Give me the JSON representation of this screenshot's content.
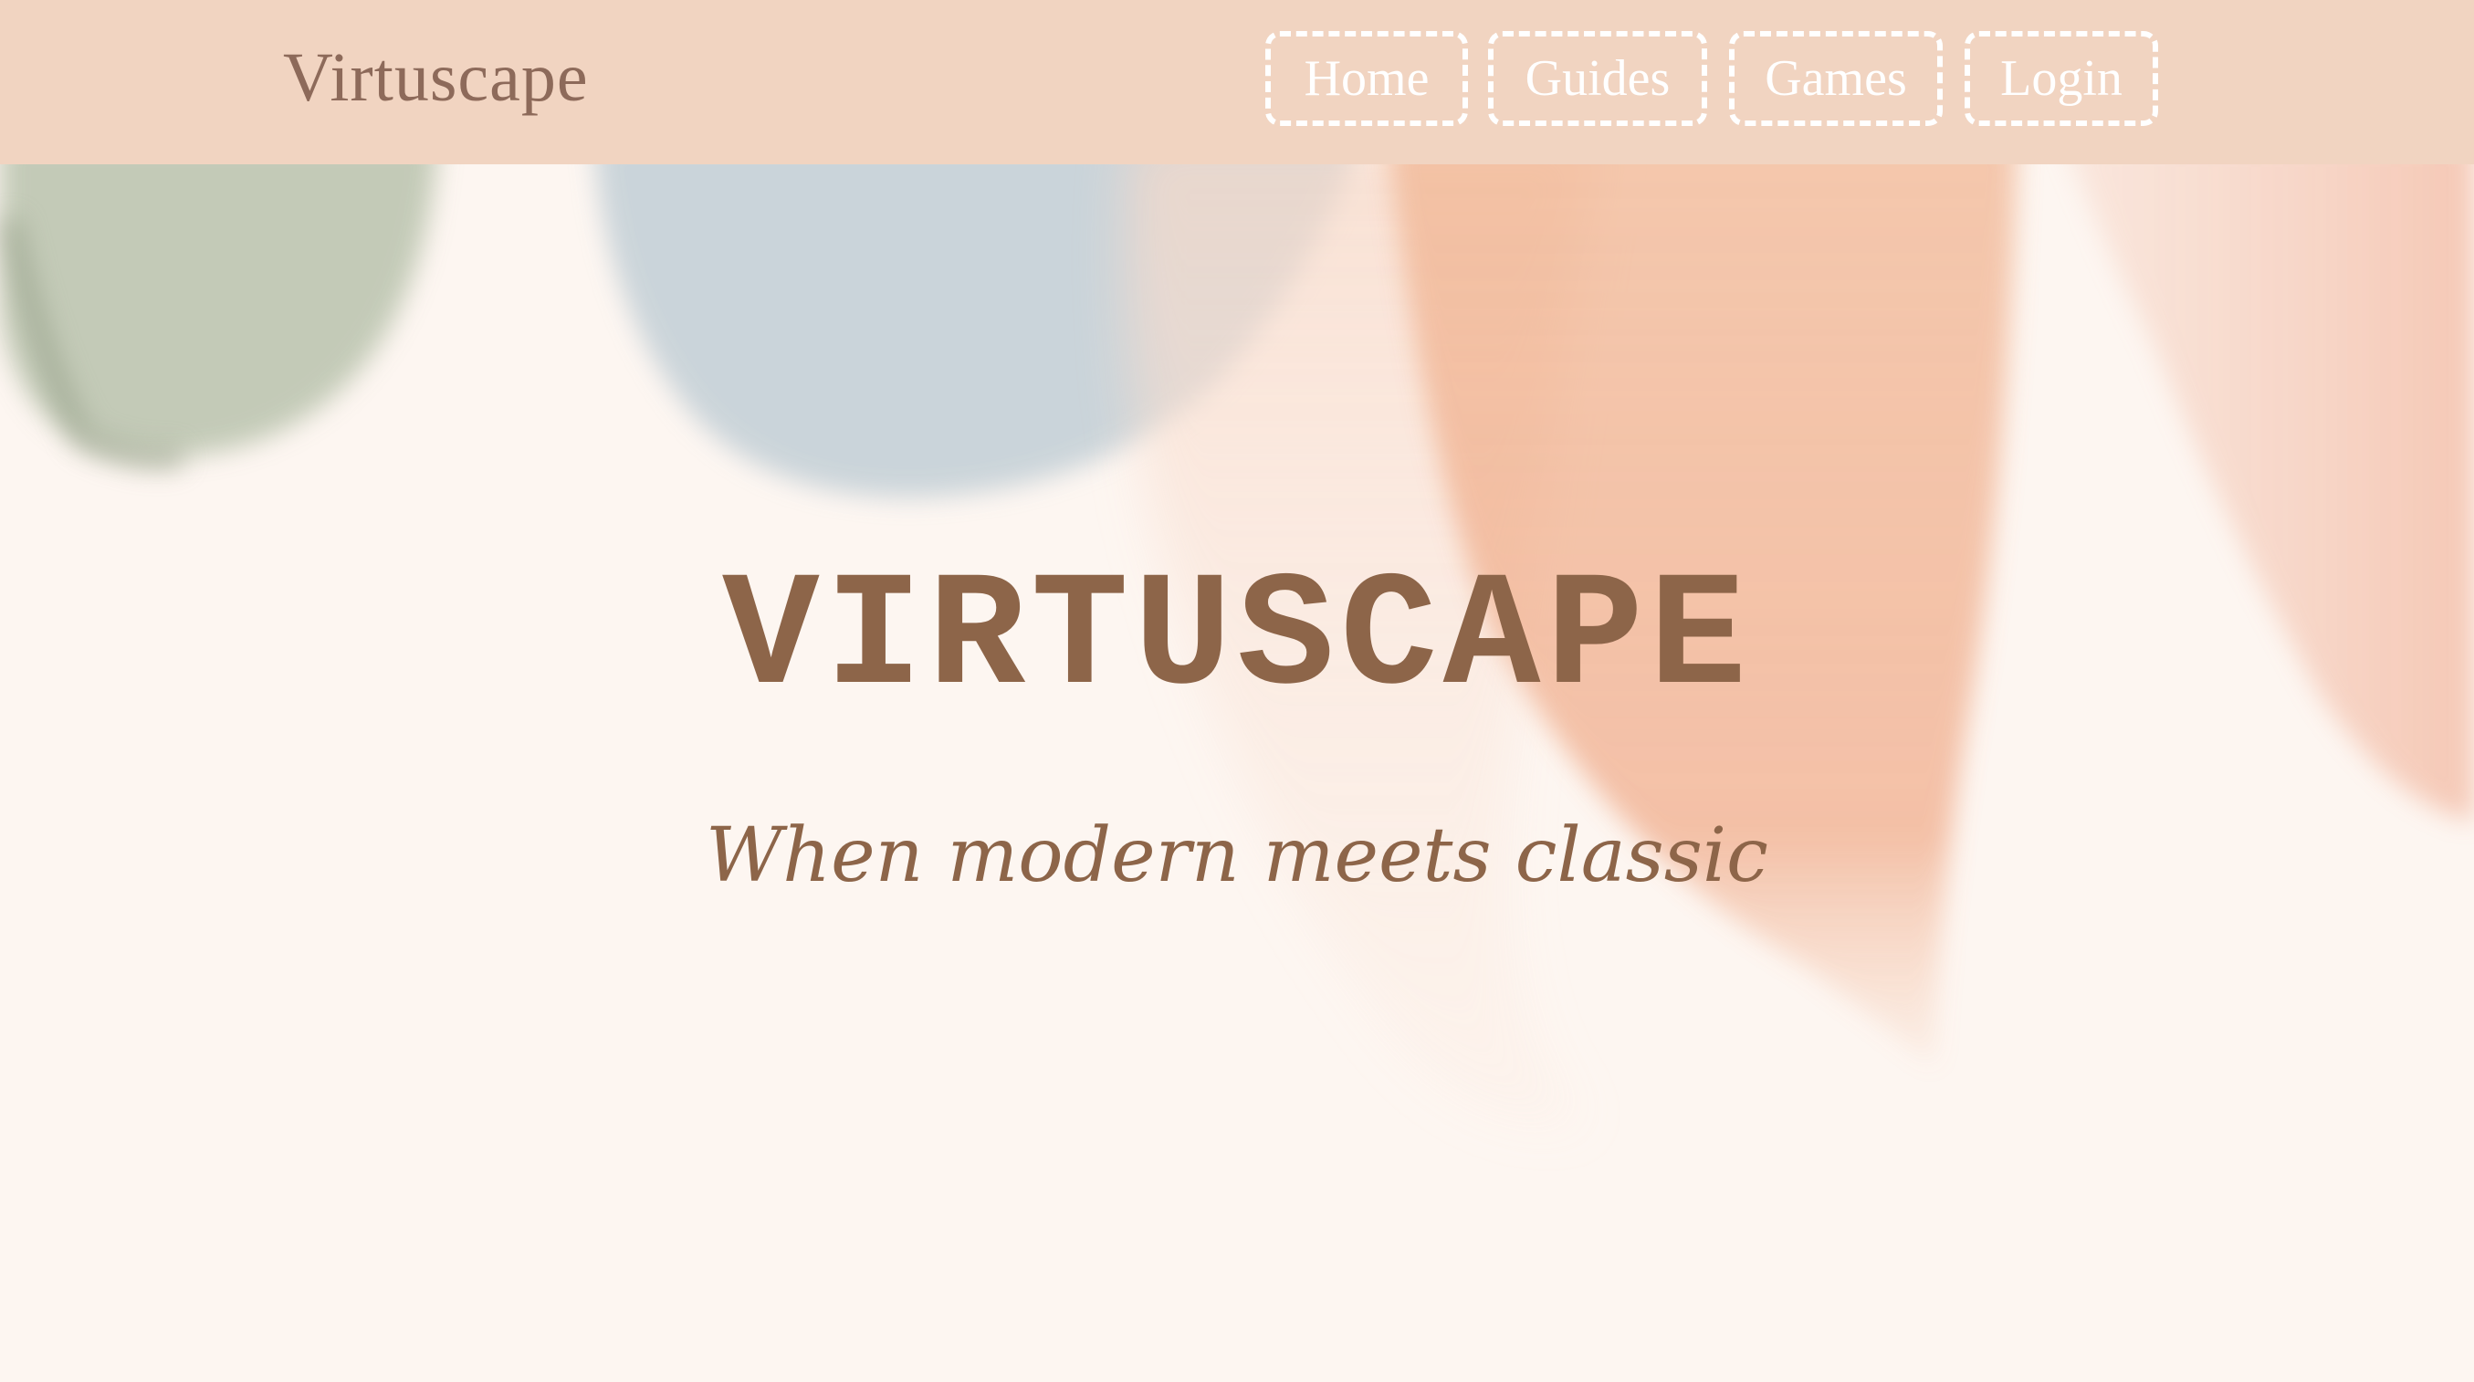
{
  "header": {
    "brand": "Virtuscape",
    "nav": [
      {
        "label": "Home"
      },
      {
        "label": "Guides"
      },
      {
        "label": "Games"
      },
      {
        "label": "Login"
      }
    ]
  },
  "hero": {
    "title": "VIRTUSCAPE",
    "subtitle": "When modern meets classic"
  },
  "colors": {
    "navbar_bg": "#f1d4c1",
    "page_bg": "#fdf6f1",
    "text_brown": "#8d6549",
    "nav_border": "#ffffff"
  }
}
